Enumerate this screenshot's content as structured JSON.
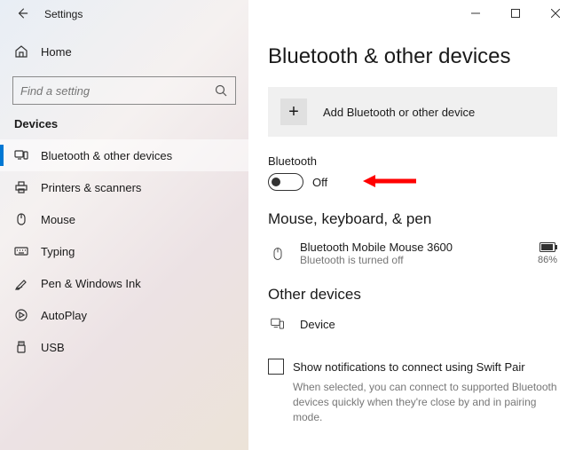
{
  "window": {
    "title": "Settings"
  },
  "sidebar": {
    "home_label": "Home",
    "search_placeholder": "Find a setting",
    "group_label": "Devices",
    "items": [
      {
        "label": "Bluetooth & other devices"
      },
      {
        "label": "Printers & scanners"
      },
      {
        "label": "Mouse"
      },
      {
        "label": "Typing"
      },
      {
        "label": "Pen & Windows Ink"
      },
      {
        "label": "AutoPlay"
      },
      {
        "label": "USB"
      }
    ]
  },
  "main": {
    "heading": "Bluetooth & other devices",
    "add_device_label": "Add Bluetooth or other device",
    "bluetooth_label": "Bluetooth",
    "bluetooth_state": "Off",
    "section_mouse": "Mouse, keyboard, & pen",
    "device": {
      "name": "Bluetooth Mobile Mouse 3600",
      "status": "Bluetooth is turned off",
      "battery": "86%"
    },
    "section_other": "Other devices",
    "other_device_label": "Device",
    "swift_pair_label": "Show notifications to connect using Swift Pair",
    "swift_pair_help": "When selected, you can connect to supported Bluetooth devices quickly when they're close by and in pairing mode."
  }
}
